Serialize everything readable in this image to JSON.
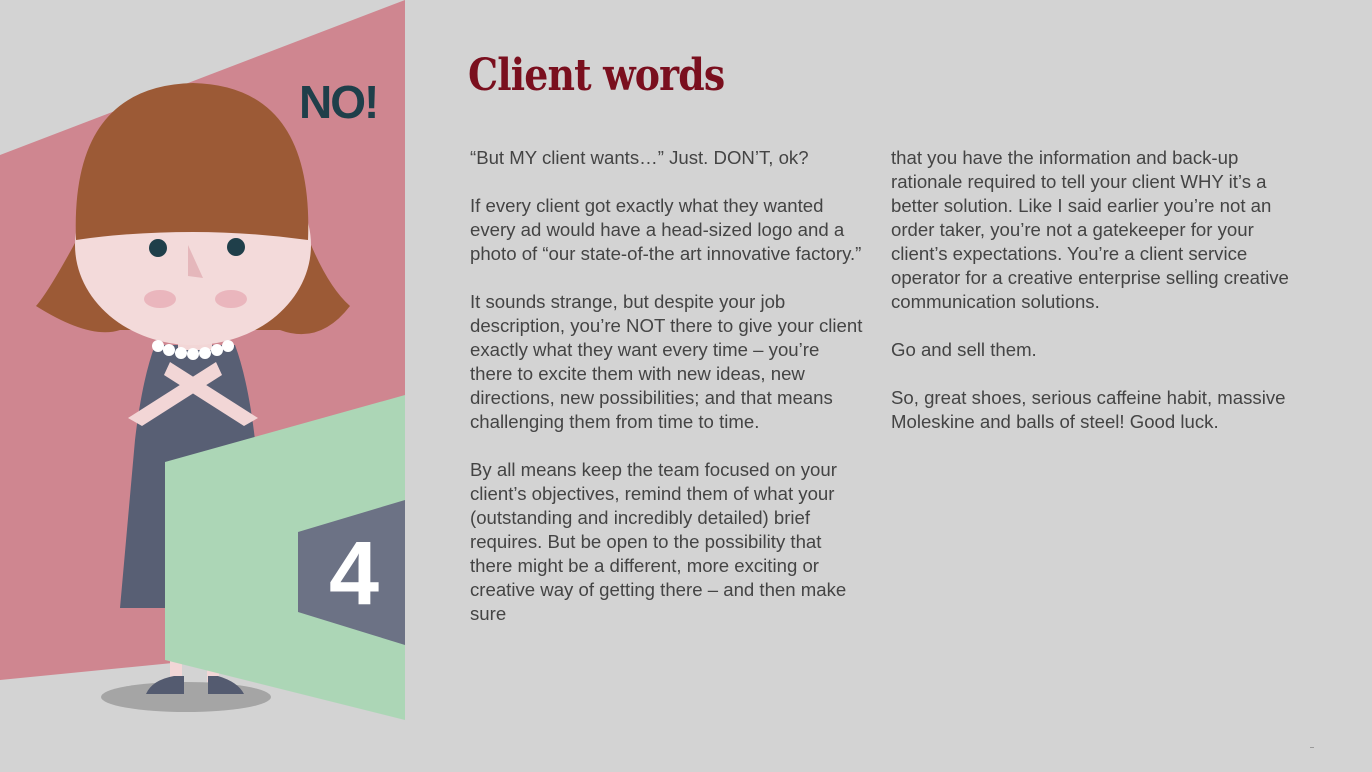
{
  "slide": {
    "title": "Client words",
    "illustration": {
      "shout_text": "NO!",
      "step_number": "4",
      "character": "woman-with-crossed-arms",
      "colors": {
        "background": "#d3d3d3",
        "pink_panel": "#cf8690",
        "green_panel": "#acd6b6",
        "number_hexagon": "#6c7285",
        "hair": "#9c5a36",
        "dress": "#585f74",
        "skin": "#f3dada",
        "shout_text": "#1f3f4a",
        "title": "#7a0f1e"
      }
    },
    "column_left": {
      "paragraphs": [
        "“But MY client wants…” Just. DON’T, ok?",
        "If every client got exactly what they wanted every ad would have a head-sized logo and a photo of “our state-of-the art innovative factory.”",
        "It sounds strange, but despite your job description, you’re NOT there to give your client exactly what they want every time – you’re there to excite them with new ideas, new directions, new possibilities; and that means challenging them from time to time.",
        "By all means keep the team focused on your client’s objectives, remind them of what your (outstanding and incredibly detailed) brief requires. But be open to the possibility that there might be a different, more exciting or creative way of getting there – and then make sure"
      ]
    },
    "column_right": {
      "paragraphs": [
        "that you have the information and back-up rationale required to tell your client WHY it’s a better solution. Like I said earlier you’re not an order taker, you’re not a gatekeeper for your client’s expectations. You’re a client service operator for a creative enterprise selling creative communication solutions.",
        "Go and sell them.",
        "So, great shoes, serious caffeine habit, massive Moleskine and balls of steel! Good luck."
      ]
    }
  }
}
